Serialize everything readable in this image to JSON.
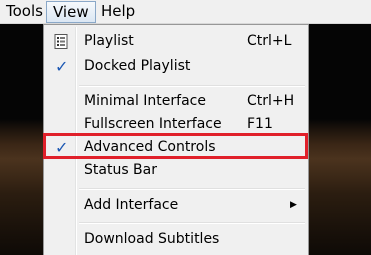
{
  "menubar": {
    "tools": "Tools",
    "view": "View",
    "help": "Help"
  },
  "view_menu": {
    "playlist": {
      "label": "Playlist",
      "shortcut": "Ctrl+L"
    },
    "docked_playlist": {
      "label": "Docked Playlist",
      "checked": true
    },
    "minimal_interface": {
      "label": "Minimal Interface",
      "shortcut": "Ctrl+H"
    },
    "fullscreen_interface": {
      "label": "Fullscreen Interface",
      "shortcut": "F11"
    },
    "advanced_controls": {
      "label": "Advanced Controls",
      "checked": true
    },
    "status_bar": {
      "label": "Status Bar"
    },
    "add_interface": {
      "label": "Add Interface"
    },
    "download_subtitles": {
      "label": "Download Subtitles"
    }
  },
  "colors": {
    "highlight_border": "#e0202a",
    "check_mark": "#1d58b3"
  }
}
